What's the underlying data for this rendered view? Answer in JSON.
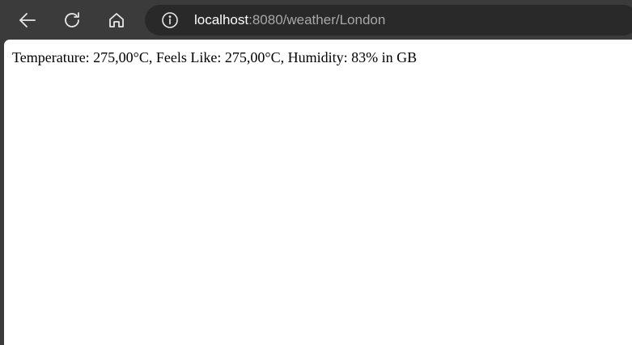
{
  "toolbar": {
    "back_icon": "arrow-left-icon",
    "reload_icon": "reload-icon",
    "home_icon": "home-icon",
    "icon_color": "#e8e8e8"
  },
  "address_bar": {
    "info_icon": "info-icon",
    "url_host": "localhost",
    "url_rest": ":8080/weather/London"
  },
  "page": {
    "text": "Temperature: 275,00°C, Feels Like: 275,00°C, Humidity: 83% in GB"
  },
  "colors": {
    "frame": "#3b3b3b",
    "address_bar": "#292929",
    "page_background": "#ffffff"
  }
}
